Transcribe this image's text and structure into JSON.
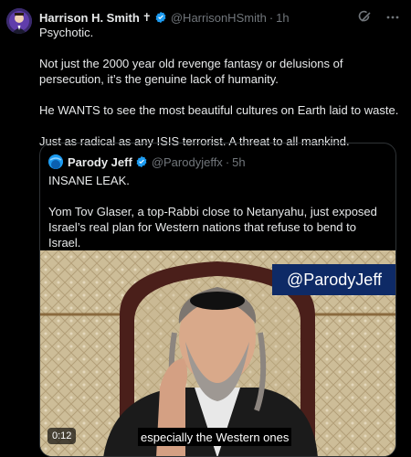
{
  "post": {
    "author_name": "Harrison H. Smith",
    "author_symbol": "✝",
    "handle": "@HarrisonHSmith",
    "separator": "·",
    "time": "1h",
    "paragraphs": [
      "Psychotic.",
      "Not just the 2000 year old revenge fantasy or delusions of persecution, it’s the genuine lack of humanity.",
      "He WANTS to see the most beautiful cultures on Earth laid to waste.",
      "Just as radical as any ISIS terrorist. A threat to all mankind."
    ],
    "icons": {
      "grok": "grok-icon",
      "more": "more-options-icon"
    }
  },
  "quote": {
    "author_name": "Parody Jeff",
    "handle": "@Parodyjeffx",
    "separator": "·",
    "time": "5h",
    "paragraphs": [
      "INSANE LEAK.",
      "Yom Tov Glaser, a top-Rabbi close to Netanyahu, just exposed Israel’s real plan for Western nations that refuse to bend to Israel.",
      "..."
    ],
    "video": {
      "watermark": "@ParodyJeff",
      "duration": "0:12",
      "caption": "especially the Western ones"
    }
  },
  "colors": {
    "background": "#000000",
    "text": "#e7e9ea",
    "muted": "#71767b",
    "verified": "#1d9bf0",
    "border": "#2f3336"
  }
}
